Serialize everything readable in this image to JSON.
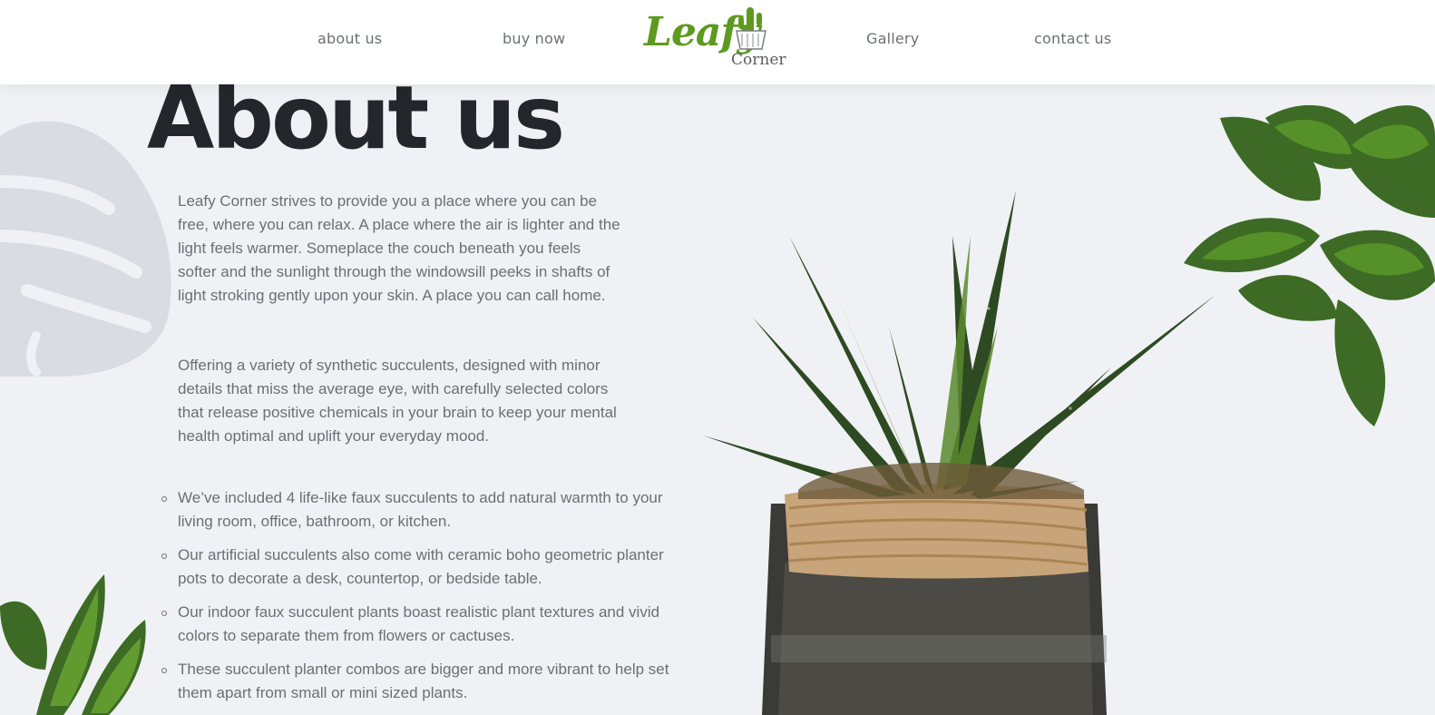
{
  "nav": {
    "about": "about us",
    "buy": "buy now",
    "gallery": "Gallery",
    "contact": "contact us"
  },
  "logo": {
    "name": "Leafy",
    "sub": "Corner",
    "icon": "cactus-pot-icon"
  },
  "page": {
    "title": "About us",
    "paragraphs": [
      "Leafy Corner strives to provide you a place where you can be free, where you can relax. A place where the air is lighter and the light feels warmer. Someplace the couch beneath you feels softer and the sunlight through the windowsill peeks in shafts of light stroking gently upon your skin. A place you can call home.",
      "Offering a variety of synthetic succulents, designed with minor details that miss the average eye, with carefully selected colors that release positive chemicals in your brain to keep your mental health optimal and uplift your everyday mood."
    ],
    "features": [
      "We’ve included 4 life-like faux succulents to add natural warmth to your living room, office, bathroom, or kitchen.",
      "Our artificial succulents also come with ceramic boho geometric planter pots to decorate a desk, countertop, or bedside table.",
      "Our indoor faux succulent plants boast realistic plant textures and vivid colors to separate them from flowers or cactuses.",
      "These succulent planter combos are bigger and more vibrant to help set them apart from small or mini sized plants."
    ]
  },
  "colors": {
    "brand_green": "#5d9a1f",
    "title": "#23262b",
    "body_text": "#6b6f74",
    "background": "#f0f1f4"
  }
}
